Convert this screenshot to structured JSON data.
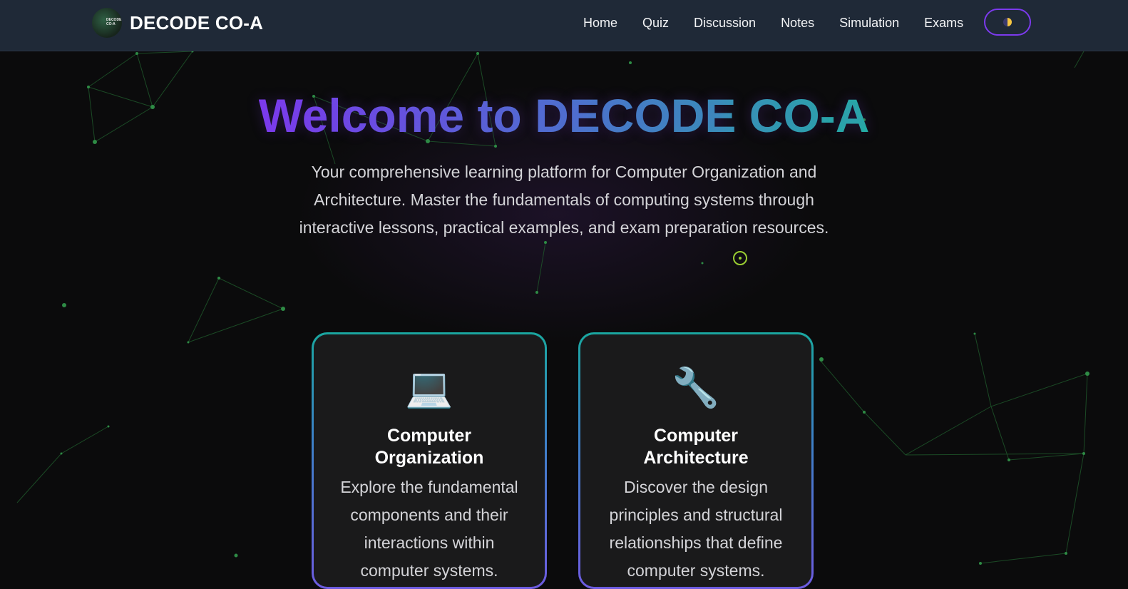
{
  "brand": {
    "logo_text": "DECODE CO-A",
    "title": "DECODE CO-A"
  },
  "nav": {
    "links": [
      "Home",
      "Quiz",
      "Discussion",
      "Notes",
      "Simulation",
      "Exams"
    ],
    "theme_toggle_icon": "half-moon-sun-icon"
  },
  "hero": {
    "title": "Welcome to DECODE CO-A",
    "subtitle": "Your comprehensive learning platform for Computer Organization and Architecture. Master the fundamentals of computing systems through interactive lessons, practical examples, and exam preparation resources."
  },
  "cards": [
    {
      "icon": "💻",
      "icon_name": "laptop-icon",
      "title": "Computer Organization",
      "description": "Explore the fundamental components and their interactions within computer systems."
    },
    {
      "icon": "🔧",
      "icon_name": "wrench-icon",
      "title": "Computer Architecture",
      "description": "Discover the design principles and structural relationships that define computer systems."
    }
  ],
  "colors": {
    "navbar": "#1f2937",
    "background": "#0b0b0c",
    "accent_purple": "#7c3aed",
    "accent_teal": "#1fb4a0",
    "network_green": "#22c55e"
  }
}
